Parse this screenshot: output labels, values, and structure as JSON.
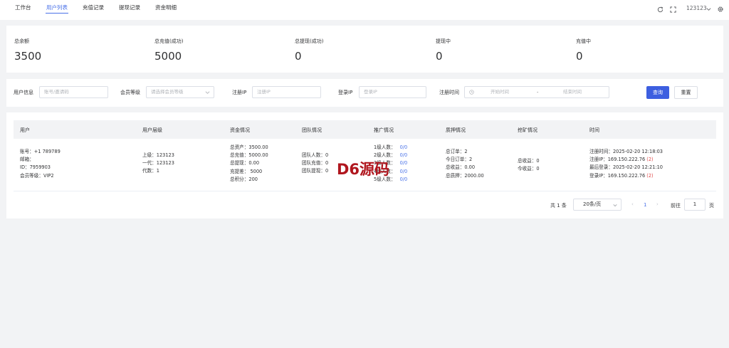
{
  "nav": {
    "tabs": [
      "工作台",
      "用户列表",
      "充值记录",
      "提现记录",
      "资金明细"
    ],
    "active_index": 1,
    "username": "123123"
  },
  "stats": [
    {
      "label": "总余额",
      "value": "3500"
    },
    {
      "label": "总充值(成功)",
      "value": "5000"
    },
    {
      "label": "总提现(成功)",
      "value": "0"
    },
    {
      "label": "提现中",
      "value": "0"
    },
    {
      "label": "充值中",
      "value": "0"
    }
  ],
  "filters": {
    "user_info": {
      "label": "用户信息",
      "placeholder": "账号/邀请码"
    },
    "member_level": {
      "label": "会员等级",
      "placeholder": "请选择会员等级"
    },
    "reg_ip": {
      "label": "注册IP",
      "placeholder": "注册IP"
    },
    "login_ip": {
      "label": "登录IP",
      "placeholder": "登录IP"
    },
    "reg_time": {
      "label": "注册时间",
      "start": "开始时间",
      "sep": "-",
      "end": "结束时间"
    },
    "query_btn": "查询",
    "reset_btn": "重置"
  },
  "table": {
    "headers": [
      "用户",
      "用户层级",
      "资金情况",
      "团队情况",
      "推广情况",
      "质押情况",
      "挖矿情况",
      "时间"
    ],
    "row": {
      "user": [
        "账号：+1 789789",
        "邮箱：",
        "ID：7959903",
        "会员等级：VIP2"
      ],
      "level": [
        "上级：123123",
        "一代：123123",
        "代数：1"
      ],
      "funds": [
        "总资产：3500.00",
        "总充值：5000.00",
        "总提现：0.00",
        "充提差： 5000",
        "总积分：200"
      ],
      "team": [
        "团队人数：0",
        "团队充值：0",
        "团队提现：0"
      ],
      "promo": [
        {
          "label": "1级人数：",
          "value": "0/0"
        },
        {
          "label": "2级人数：",
          "value": "0/0"
        },
        {
          "label": "3级人数：",
          "value": "0/0"
        },
        {
          "label": "4级人数：",
          "value": "0/0"
        },
        {
          "label": "5级人数：",
          "value": "0/0"
        }
      ],
      "pledge": [
        "总订单：2",
        "今日订单：2",
        "总收益：0.00",
        "总质押：2000.00"
      ],
      "mining": [
        "总收益：0",
        "今收益：0"
      ],
      "time": {
        "reg_time": "注册时间：2025-02-20 12:18:03",
        "reg_ip": "注册IP：169.150.222.76",
        "reg_ip_count": "(2)",
        "last_login": "最后登录：2025-02-20 12:21:10",
        "login_ip": "登录IP：169.150.222.76",
        "login_ip_count": "(2)"
      }
    }
  },
  "pagination": {
    "total": "共 1 条",
    "page_size": "20条/页",
    "prev": "‹",
    "current": "1",
    "next": "›",
    "goto_label": "前往",
    "goto_value": "1",
    "page_suffix": "页"
  },
  "watermark": "D6源码",
  "colors": {
    "accent": "#4a72e8",
    "primary_button": "#3d5fe0",
    "danger": "#e04a4a",
    "watermark": "#b0161e"
  }
}
